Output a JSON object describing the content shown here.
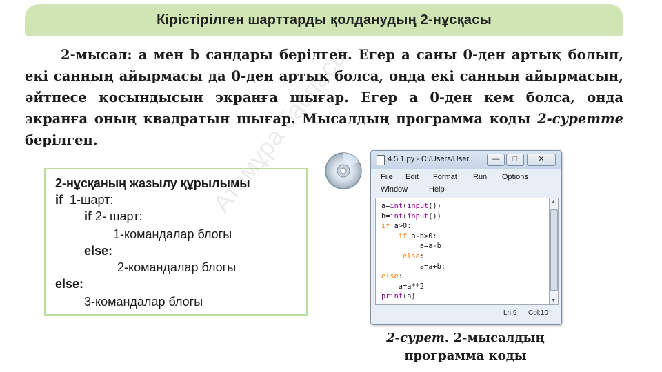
{
  "banner": {
    "title": "Кірістірілген шарттарды қолданудың 2-нұсқасы"
  },
  "paragraph": {
    "lead": "2-мысал:",
    "body1": " а мен b сандары берілген. Егер а саны 0-ден артық болып, екі санның айырмасы да 0-ден артық болса, онда екі санның айырмасын, әйтпесе қосындысын экранға шығар. Егер а 0-ден кем болса, онда экранға оның квадратын шығар. Мысалдың программа коды ",
    "ref": "2-суретте",
    "body2": " берілген."
  },
  "syntax_box": {
    "title": "2-нұсқаның жазылу құрылымы",
    "line_if1_kw": "if",
    "line_if1_text": "1-шарт:",
    "line_if2_kw": "if",
    "line_if2_text": "2- шарт:",
    "line_block1": "1-командалар блогы",
    "line_else_inner": "else:",
    "line_block2": "2-командалар блогы",
    "line_else_outer": "else:",
    "line_block3": "3-командалар блогы"
  },
  "ide": {
    "title": "4.5.1.py - C:/Users/User...",
    "menu": [
      "File",
      "Edit",
      "Format",
      "Run",
      "Options",
      "Window",
      "Help"
    ],
    "code": {
      "l1a": "a=",
      "l1b": "int",
      "l1c": "(",
      "l1d": "input",
      "l1e": "())",
      "l2a": "b=",
      "l2b": "int",
      "l2c": "(",
      "l2d": "input",
      "l2e": "())",
      "l3a": "if",
      "l3b": " a>0:",
      "l4a": "    if",
      "l4b": " a-b>0:",
      "l5": "         a=a-b",
      "l6a": "     else",
      "l6b": ":",
      "l7": "         a=a+b;",
      "l8a": "else",
      "l8b": ":",
      "l9": "    a=a**2",
      "l10a": "print",
      "l10b": "(a)"
    },
    "status_line": "Ln:9",
    "status_col": "Col:10"
  },
  "caption": {
    "ref": "2-сурет.",
    "rest": " 2-мысалдың программа коды"
  },
  "watermark": "Атамұра баспасы",
  "colors": {
    "banner": "#cfe6b4",
    "box_border": "#b9dd9c",
    "keyword": "#ff7700",
    "builtin": "#900090"
  },
  "icons": {
    "disc": "cd-disc-icon"
  }
}
